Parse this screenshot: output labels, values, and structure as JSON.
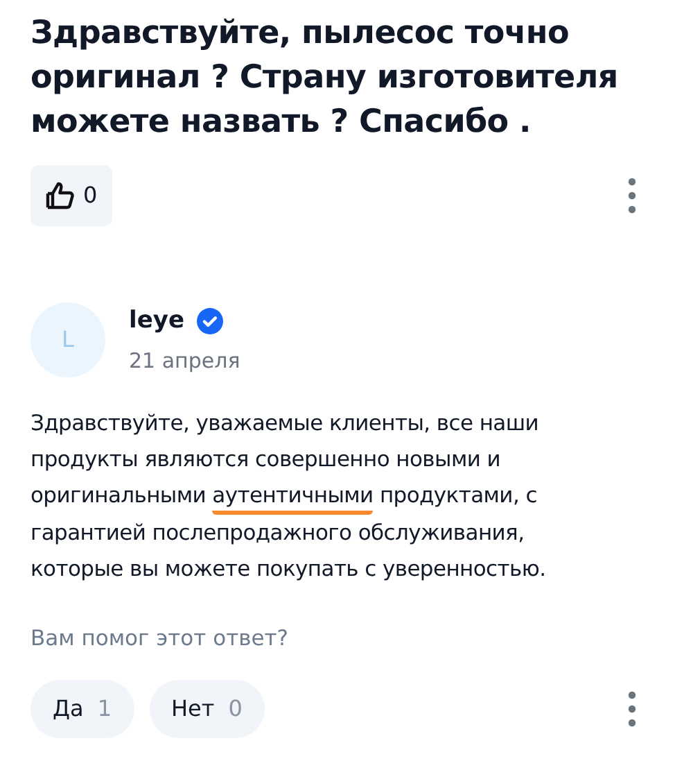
{
  "question": {
    "text": "Здравствуйте, пылесос точно оригинал ? Страну изготовителя можете назвать ? Спасибо .",
    "likes": "0"
  },
  "answer": {
    "avatar_letter": "L",
    "author": "leye",
    "verified": true,
    "date": "21 апреля",
    "text_segments": [
      {
        "text": "Здравствуйте, уважаемые клиенты, все наши продукты являются совершенно новыми и оригинальными ",
        "underlined": false
      },
      {
        "text": "аутентичными",
        "underlined": true
      },
      {
        "text": " продуктами, с гарантией послепродажного обслуживания, которые вы можете покупать с уверенностью.",
        "underlined": false
      }
    ],
    "helpful_prompt": "Вам помог этот ответ?",
    "votes": [
      {
        "label": "Да",
        "count": "1"
      },
      {
        "label": "Нет",
        "count": "0"
      }
    ]
  }
}
